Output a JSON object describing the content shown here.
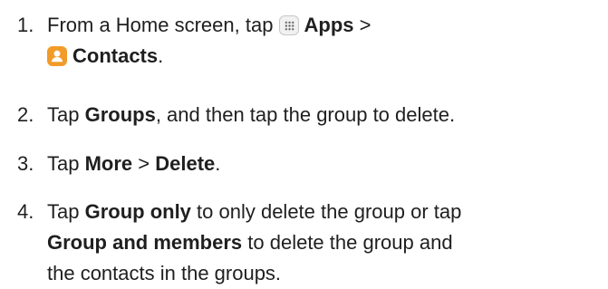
{
  "steps": [
    {
      "number": "1.",
      "line1_pre": "From a Home screen, tap ",
      "apps": "Apps",
      "sep": " >",
      "contacts": "Contacts",
      "end": "."
    },
    {
      "number": "2.",
      "pre": "Tap ",
      "groups": "Groups",
      "post": ", and then tap the group to delete."
    },
    {
      "number": "3.",
      "pre": "Tap ",
      "more": "More",
      "sep": " > ",
      "delete": "Delete",
      "end": "."
    },
    {
      "number": "4.",
      "pre": "Tap ",
      "group_only": "Group only",
      "mid": " to only delete the group or tap",
      "group_and_members": "Group and members",
      "post1": " to delete the group and",
      "post2": "the contacts in the groups."
    }
  ],
  "icons": {
    "apps": "apps-grid-icon",
    "contacts": "contacts-person-icon"
  },
  "colors": {
    "contacts_icon": "#f29b28",
    "text": "#1f1f1f"
  }
}
